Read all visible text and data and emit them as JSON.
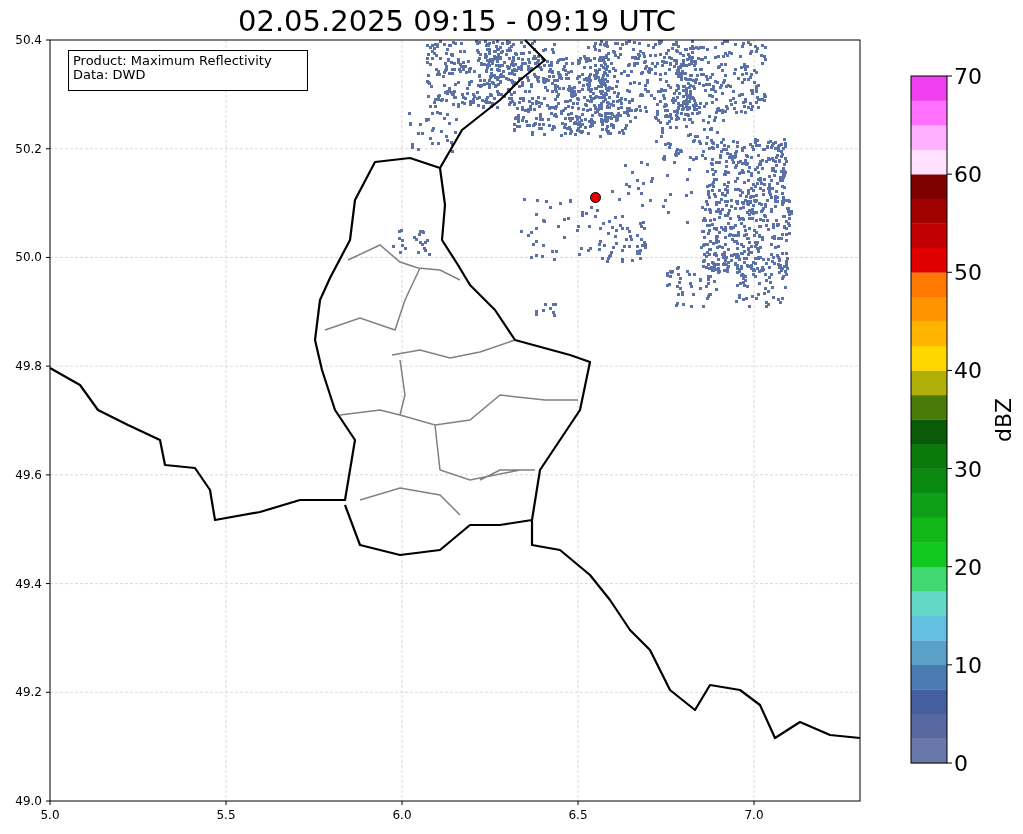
{
  "title": "02.05.2025 09:15 - 09:19 UTC",
  "info_box": [
    "Product: Maximum Reflectivity",
    "Data: DWD"
  ],
  "map": {
    "xticks": [
      "5.0",
      "5.5",
      "6.0",
      "6.5",
      "7.0"
    ],
    "yticks": [
      "50.4",
      "50.2",
      "50.0",
      "49.8",
      "49.6",
      "49.4",
      "49.2",
      "49.0"
    ]
  },
  "colorbar": {
    "label": "dBZ",
    "ticks": [
      "70",
      "60",
      "50",
      "40",
      "30",
      "20",
      "10",
      "0"
    ],
    "bands": [
      {
        "color": "#6878a8"
      },
      {
        "color": "#5868a0"
      },
      {
        "color": "#4460a0"
      },
      {
        "color": "#4a7ab0"
      },
      {
        "color": "#5aa0c8"
      },
      {
        "color": "#64c0e0"
      },
      {
        "color": "#64d8c8"
      },
      {
        "color": "#40d870"
      },
      {
        "color": "#10c820"
      },
      {
        "color": "#10b818"
      },
      {
        "color": "#10a018"
      },
      {
        "color": "#0a8a10"
      },
      {
        "color": "#0a7a0a"
      },
      {
        "color": "#0a5a0a"
      },
      {
        "color": "#4a7a08"
      },
      {
        "color": "#b0b008"
      },
      {
        "color": "#ffd700"
      },
      {
        "color": "#ffb400"
      },
      {
        "color": "#ff9400"
      },
      {
        "color": "#ff7800"
      },
      {
        "color": "#e00000"
      },
      {
        "color": "#c00000"
      },
      {
        "color": "#a00000"
      },
      {
        "color": "#800000"
      },
      {
        "color": "#ffe0ff"
      },
      {
        "color": "#ffb0ff"
      },
      {
        "color": "#ff70ff"
      },
      {
        "color": "#f040f0"
      }
    ]
  }
}
